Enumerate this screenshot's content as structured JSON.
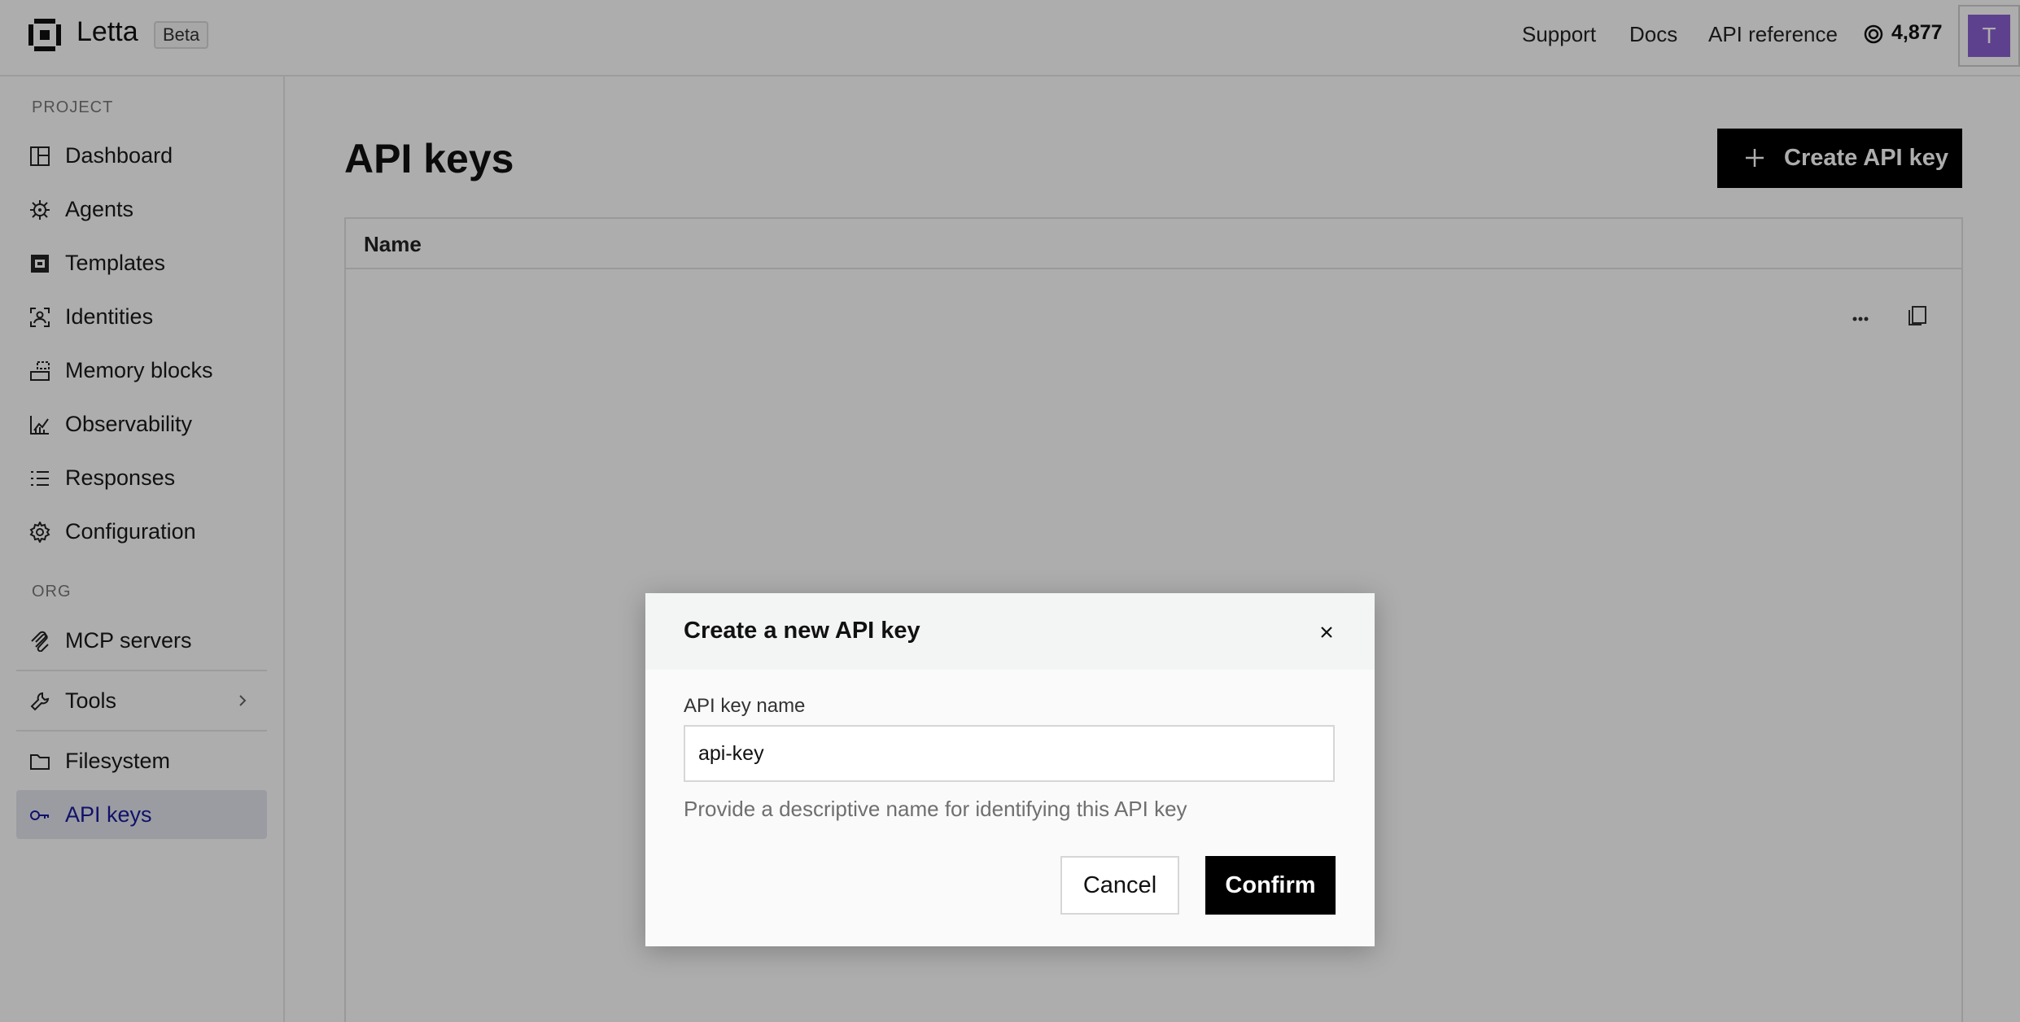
{
  "header": {
    "brand": "Letta",
    "badge": "Beta",
    "links": [
      "Support",
      "Docs",
      "API reference"
    ],
    "credits": "4,877",
    "avatar_initial": "T",
    "avatar_color": "#8b61d1"
  },
  "sidebar": {
    "project_label": "PROJECT",
    "org_label": "ORG",
    "project_items": [
      {
        "label": "Dashboard",
        "icon": "dashboard-icon"
      },
      {
        "label": "Agents",
        "icon": "agents-icon"
      },
      {
        "label": "Templates",
        "icon": "templates-icon"
      },
      {
        "label": "Identities",
        "icon": "identities-icon"
      },
      {
        "label": "Memory blocks",
        "icon": "memory-blocks-icon"
      },
      {
        "label": "Observability",
        "icon": "observability-icon"
      },
      {
        "label": "Responses",
        "icon": "responses-icon"
      },
      {
        "label": "Configuration",
        "icon": "gear-icon"
      }
    ],
    "org_items": [
      {
        "label": "MCP servers",
        "icon": "mcp-icon"
      },
      {
        "label": "Tools",
        "icon": "wrench-icon"
      },
      {
        "label": "Filesystem",
        "icon": "folder-icon"
      },
      {
        "label": "API keys",
        "icon": "key-icon",
        "active": true
      }
    ]
  },
  "main": {
    "title": "API keys",
    "create_button": "Create API key",
    "table": {
      "columns": [
        "Name"
      ]
    }
  },
  "modal": {
    "title": "Create a new API key",
    "field_label": "API key name",
    "field_value": "api-key",
    "helper": "Provide a descriptive name for identifying this API key",
    "cancel": "Cancel",
    "confirm": "Confirm"
  }
}
